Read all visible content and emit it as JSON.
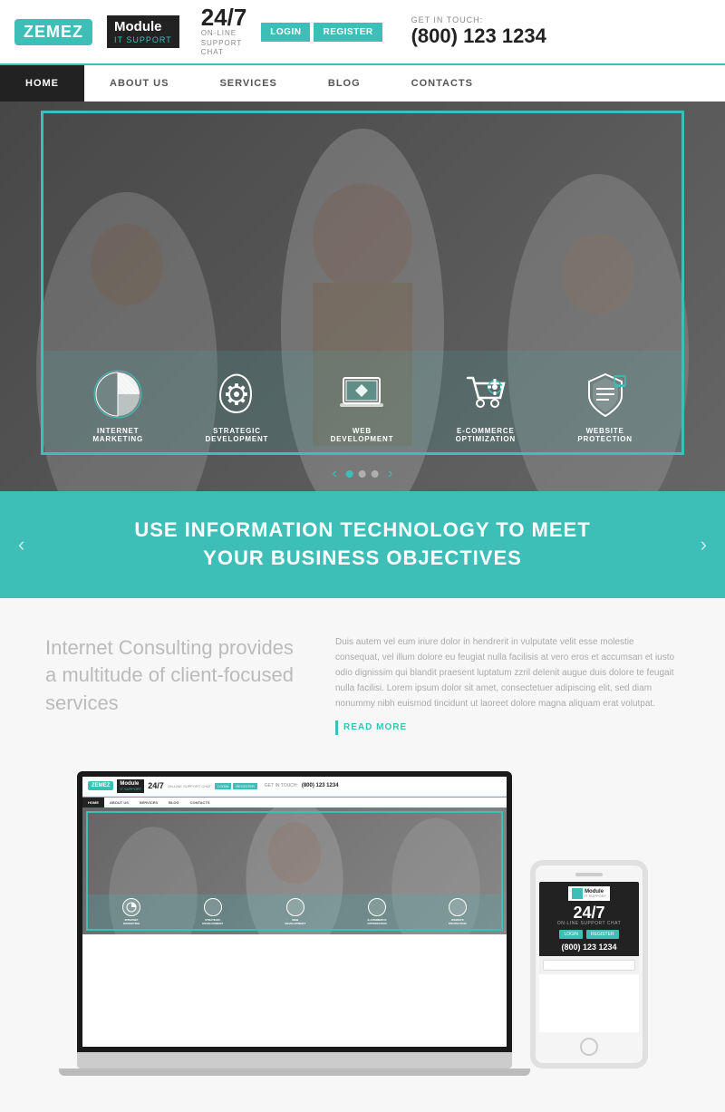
{
  "brand": {
    "zemez_label": "ZEMEZ",
    "module_title": "Module",
    "module_subtitle": "IT SUPPORT"
  },
  "header": {
    "availability": "24/7",
    "availability_sub": "ON-LINE\nSUPPORT\nCHAT",
    "login_label": "LOGIN",
    "register_label": "REGISTER",
    "get_in_touch": "GET IN TOUCH:",
    "phone": "(800) 123 1234"
  },
  "nav": {
    "items": [
      {
        "label": "HOME",
        "active": true
      },
      {
        "label": "ABOUT US",
        "active": false
      },
      {
        "label": "SERVICES",
        "active": false
      },
      {
        "label": "BLOG",
        "active": false
      },
      {
        "label": "CONTACTS",
        "active": false
      }
    ]
  },
  "hero": {
    "icons": [
      {
        "label": "INTERNET\nMARKETING",
        "icon": "pie-chart"
      },
      {
        "label": "STRATEGIC\nDEVELOPMENT",
        "icon": "brain-gear"
      },
      {
        "label": "WEB\nDEVELOPMENT",
        "icon": "laptop-diamond"
      },
      {
        "label": "E-COMMERCE\nOPTIMIZATION",
        "icon": "cart-gear"
      },
      {
        "label": "WEBSITE\nPROTECTION",
        "icon": "shield"
      }
    ],
    "prev_arrow": "‹",
    "next_arrow": "›"
  },
  "banner": {
    "text": "USE INFORMATION TECHNOLOGY TO MEET\nYOUR BUSINESS OBJECTIVES",
    "prev_arrow": "‹",
    "next_arrow": "›"
  },
  "content": {
    "heading": "Internet Consulting provides a multitude of client-focused services",
    "description": "Duis autem vel eum iriure dolor in hendrerit in vulputate velit esse molestie consequat, vel illum dolore eu feugiat nulla facilisis at vero eros et accumsan et iusto odio dignissim qui blandit praesent luptatum zzril delenit augue duis dolore te feugait nulla facilisi. Lorem ipsum dolor sit amet, consectetuer adipiscing elit, sed diam nonummy nibh euismod tincidunt ut laoreet dolore magna aliquam erat volutpat.",
    "read_more": "READ MORE"
  },
  "colors": {
    "teal": "#3dbfb8",
    "dark": "#222222",
    "light_gray": "#f7f7f7"
  }
}
